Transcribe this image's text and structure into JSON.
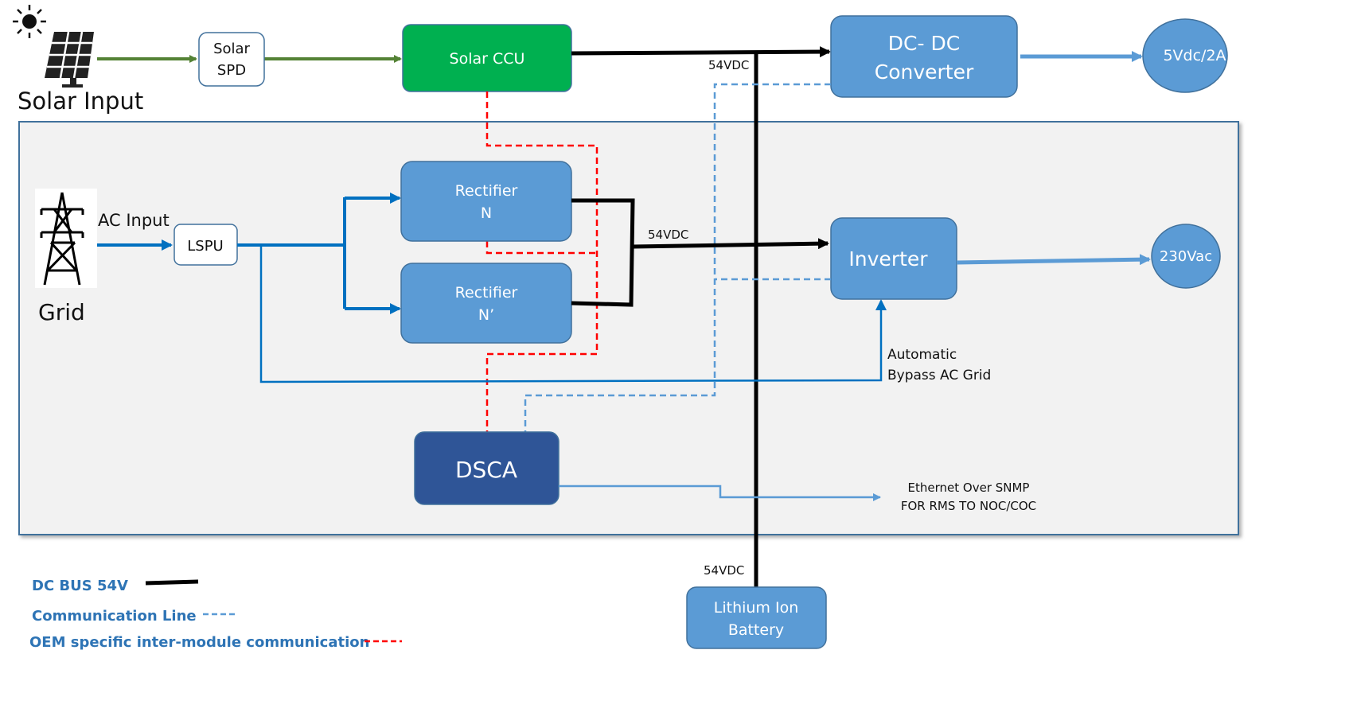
{
  "nodes": {
    "solar_input": {
      "label": "Solar Input"
    },
    "solar_spd": {
      "line1": "Solar",
      "line2": "SPD"
    },
    "solar_ccu": {
      "label": "Solar CCU"
    },
    "dc_dc_converter": {
      "line1": "DC- DC",
      "line2": "Converter"
    },
    "output_5vdc": {
      "label": "5Vdc/2A"
    },
    "grid": {
      "label": "Grid"
    },
    "lspu": {
      "label": "LSPU"
    },
    "rectifier_n": {
      "line1": "Rectifier",
      "line2": "N"
    },
    "rectifier_n_prime": {
      "line1": "Rectifier",
      "line2": "N’"
    },
    "inverter": {
      "label": "Inverter"
    },
    "output_230vac": {
      "label": "230Vac"
    },
    "dsca": {
      "label": "DSCA"
    },
    "battery": {
      "line1": "Lithium Ion",
      "line2": "Battery"
    }
  },
  "labels": {
    "ac_input": "AC Input",
    "dc_bus_top": "54VDC",
    "dc_bus_middle": "54VDC",
    "dc_bus_battery": "54VDC",
    "bypass_line1": "Automatic",
    "bypass_line2": "Bypass AC Grid",
    "ethernet_line1": "Ethernet Over SNMP",
    "ethernet_line2": "FOR RMS TO NOC/COC"
  },
  "legend": [
    {
      "label": "DC BUS 54V",
      "style": "solid",
      "color": "#000000"
    },
    {
      "label": "Communication  Line",
      "style": "dashed",
      "color": "#5b9bd5"
    },
    {
      "label": "OEM specific inter-module communication",
      "style": "dashed",
      "color": "#ff0000"
    }
  ],
  "colors": {
    "node_blue": "#5b9bd5",
    "node_dark_blue": "#2f5597",
    "node_green": "#00b050",
    "solar_arrow": "#548235",
    "ac_line": "#0070c0",
    "comm_line": "#5b9bd5",
    "oem_line": "#ff0000",
    "dc_bus": "#000000",
    "panel_bg": "#f2f2f2",
    "panel_border": "#41719c"
  }
}
